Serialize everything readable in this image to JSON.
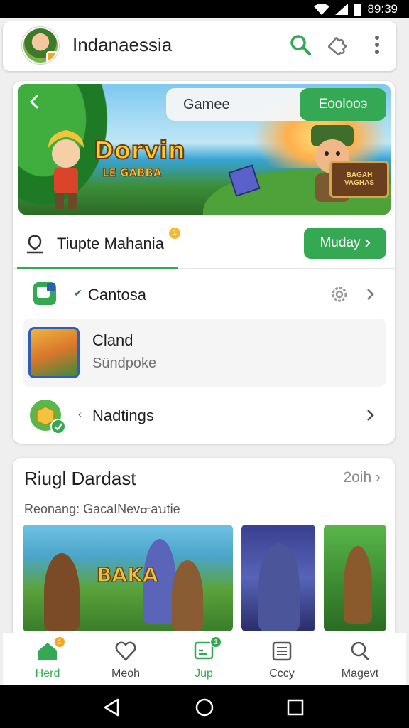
{
  "status_bar": {
    "time": "89:39"
  },
  "app_bar": {
    "title": "Indanaessia"
  },
  "banner": {
    "logo": "Dorvin",
    "logo_sub": "LE GABBA",
    "search_label": "Gameе",
    "search_button": "Eoolooэ",
    "chest_text": "BAGAH VAGHAS"
  },
  "tab_row": {
    "label": "Tiupte Mahania",
    "badge": "1",
    "button": "Muday"
  },
  "rows": {
    "row1_label": "Cantosa",
    "game_title": "Cland",
    "game_subtitle": "Sündpoke",
    "row3_label": "Nadtings"
  },
  "section": {
    "title": "Riugl Dardast",
    "more": "2oih",
    "subtitle": "Reonang: GacaINevᓂaꭒtie",
    "tile_text": "BAKA"
  },
  "bottom_nav": [
    {
      "label": "Herd",
      "badge": "1",
      "icon": "home-icon",
      "active": true
    },
    {
      "label": "Meoh",
      "badge": "",
      "icon": "heart-icon",
      "active": false
    },
    {
      "label": "Jup",
      "badge": "1",
      "icon": "chat-icon",
      "active": true
    },
    {
      "label": "Cccy",
      "badge": "",
      "icon": "grid-icon",
      "active": false
    },
    {
      "label": "Magevt",
      "badge": "",
      "icon": "search-icon",
      "active": false
    }
  ],
  "colors": {
    "accent": "#34a853",
    "badge_orange": "#f5b82e"
  }
}
